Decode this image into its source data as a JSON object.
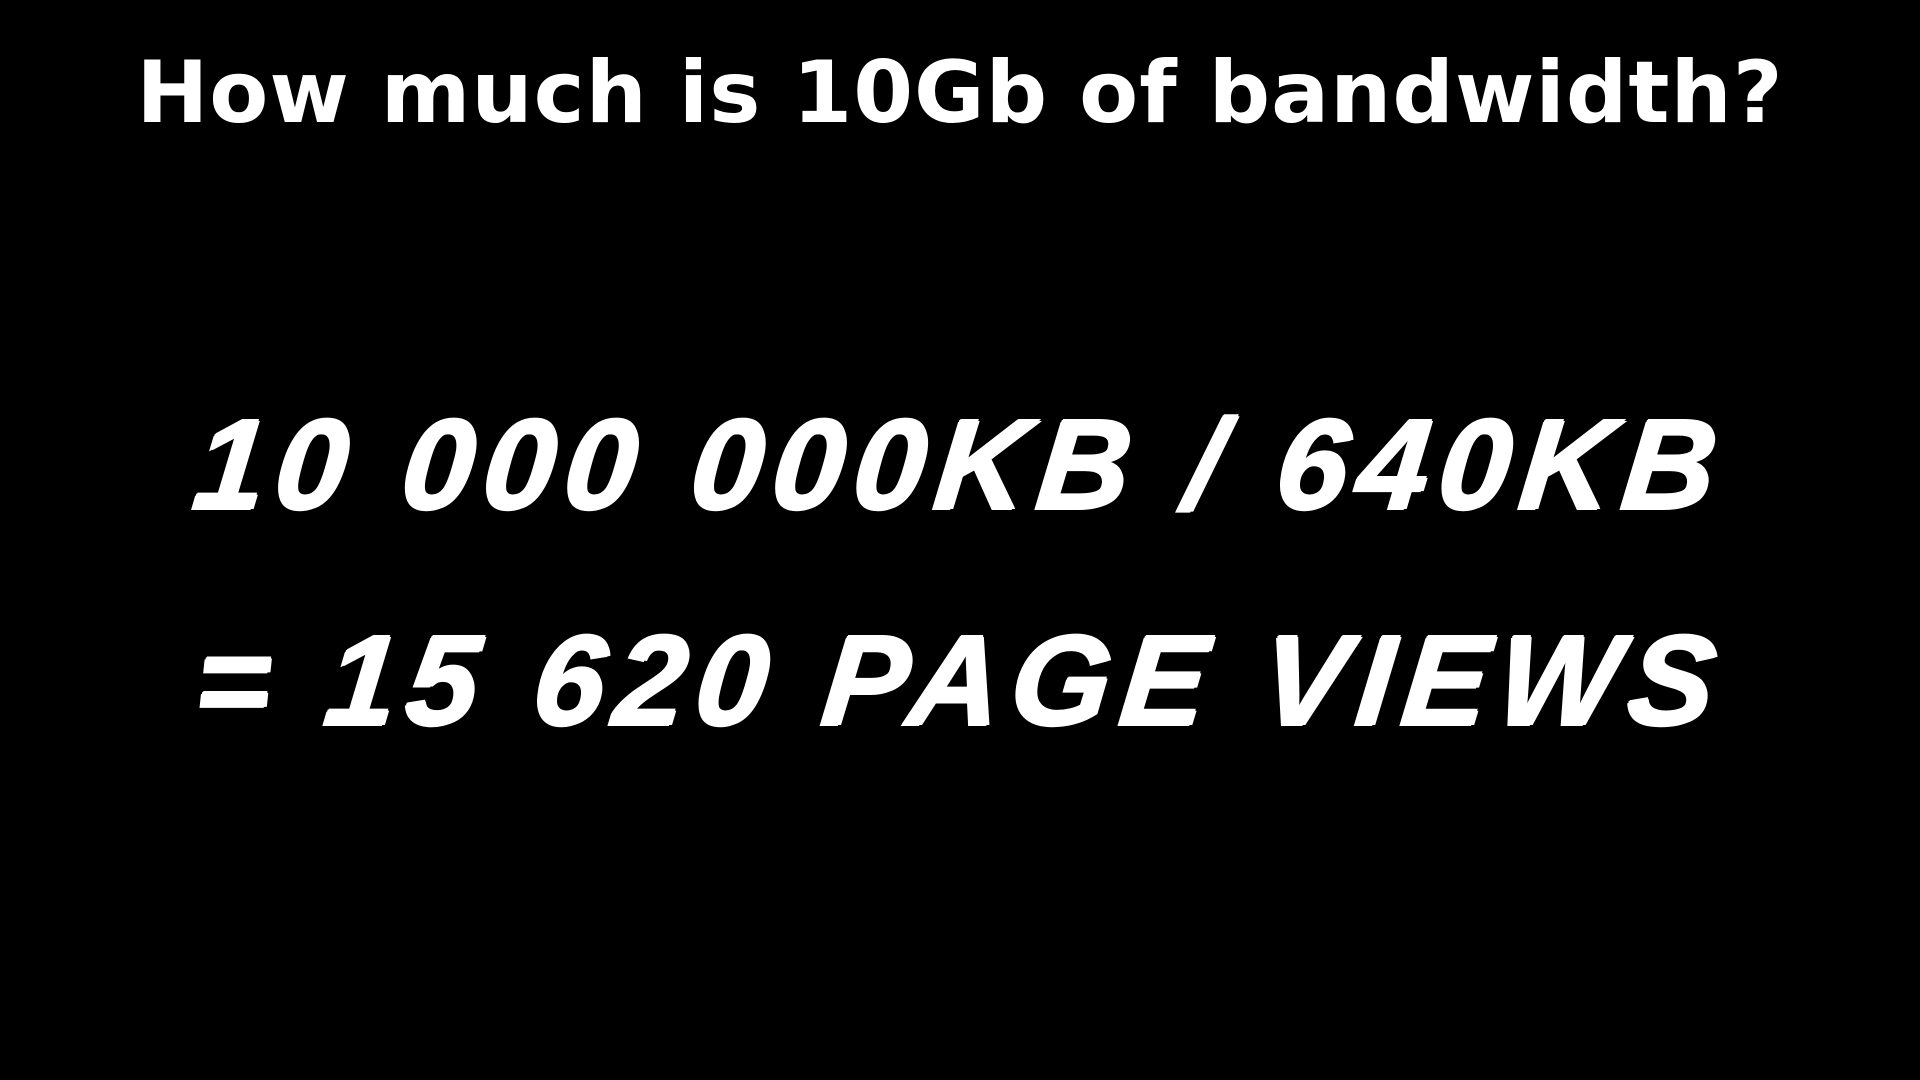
{
  "slide": {
    "title": "How much is 10Gb of bandwidth?",
    "line_1": "10 000 000KB / 640KB",
    "line_2": "= 15 620 PAGE VIEWS"
  },
  "colors": {
    "background": "#000000",
    "text": "#ffffff"
  }
}
